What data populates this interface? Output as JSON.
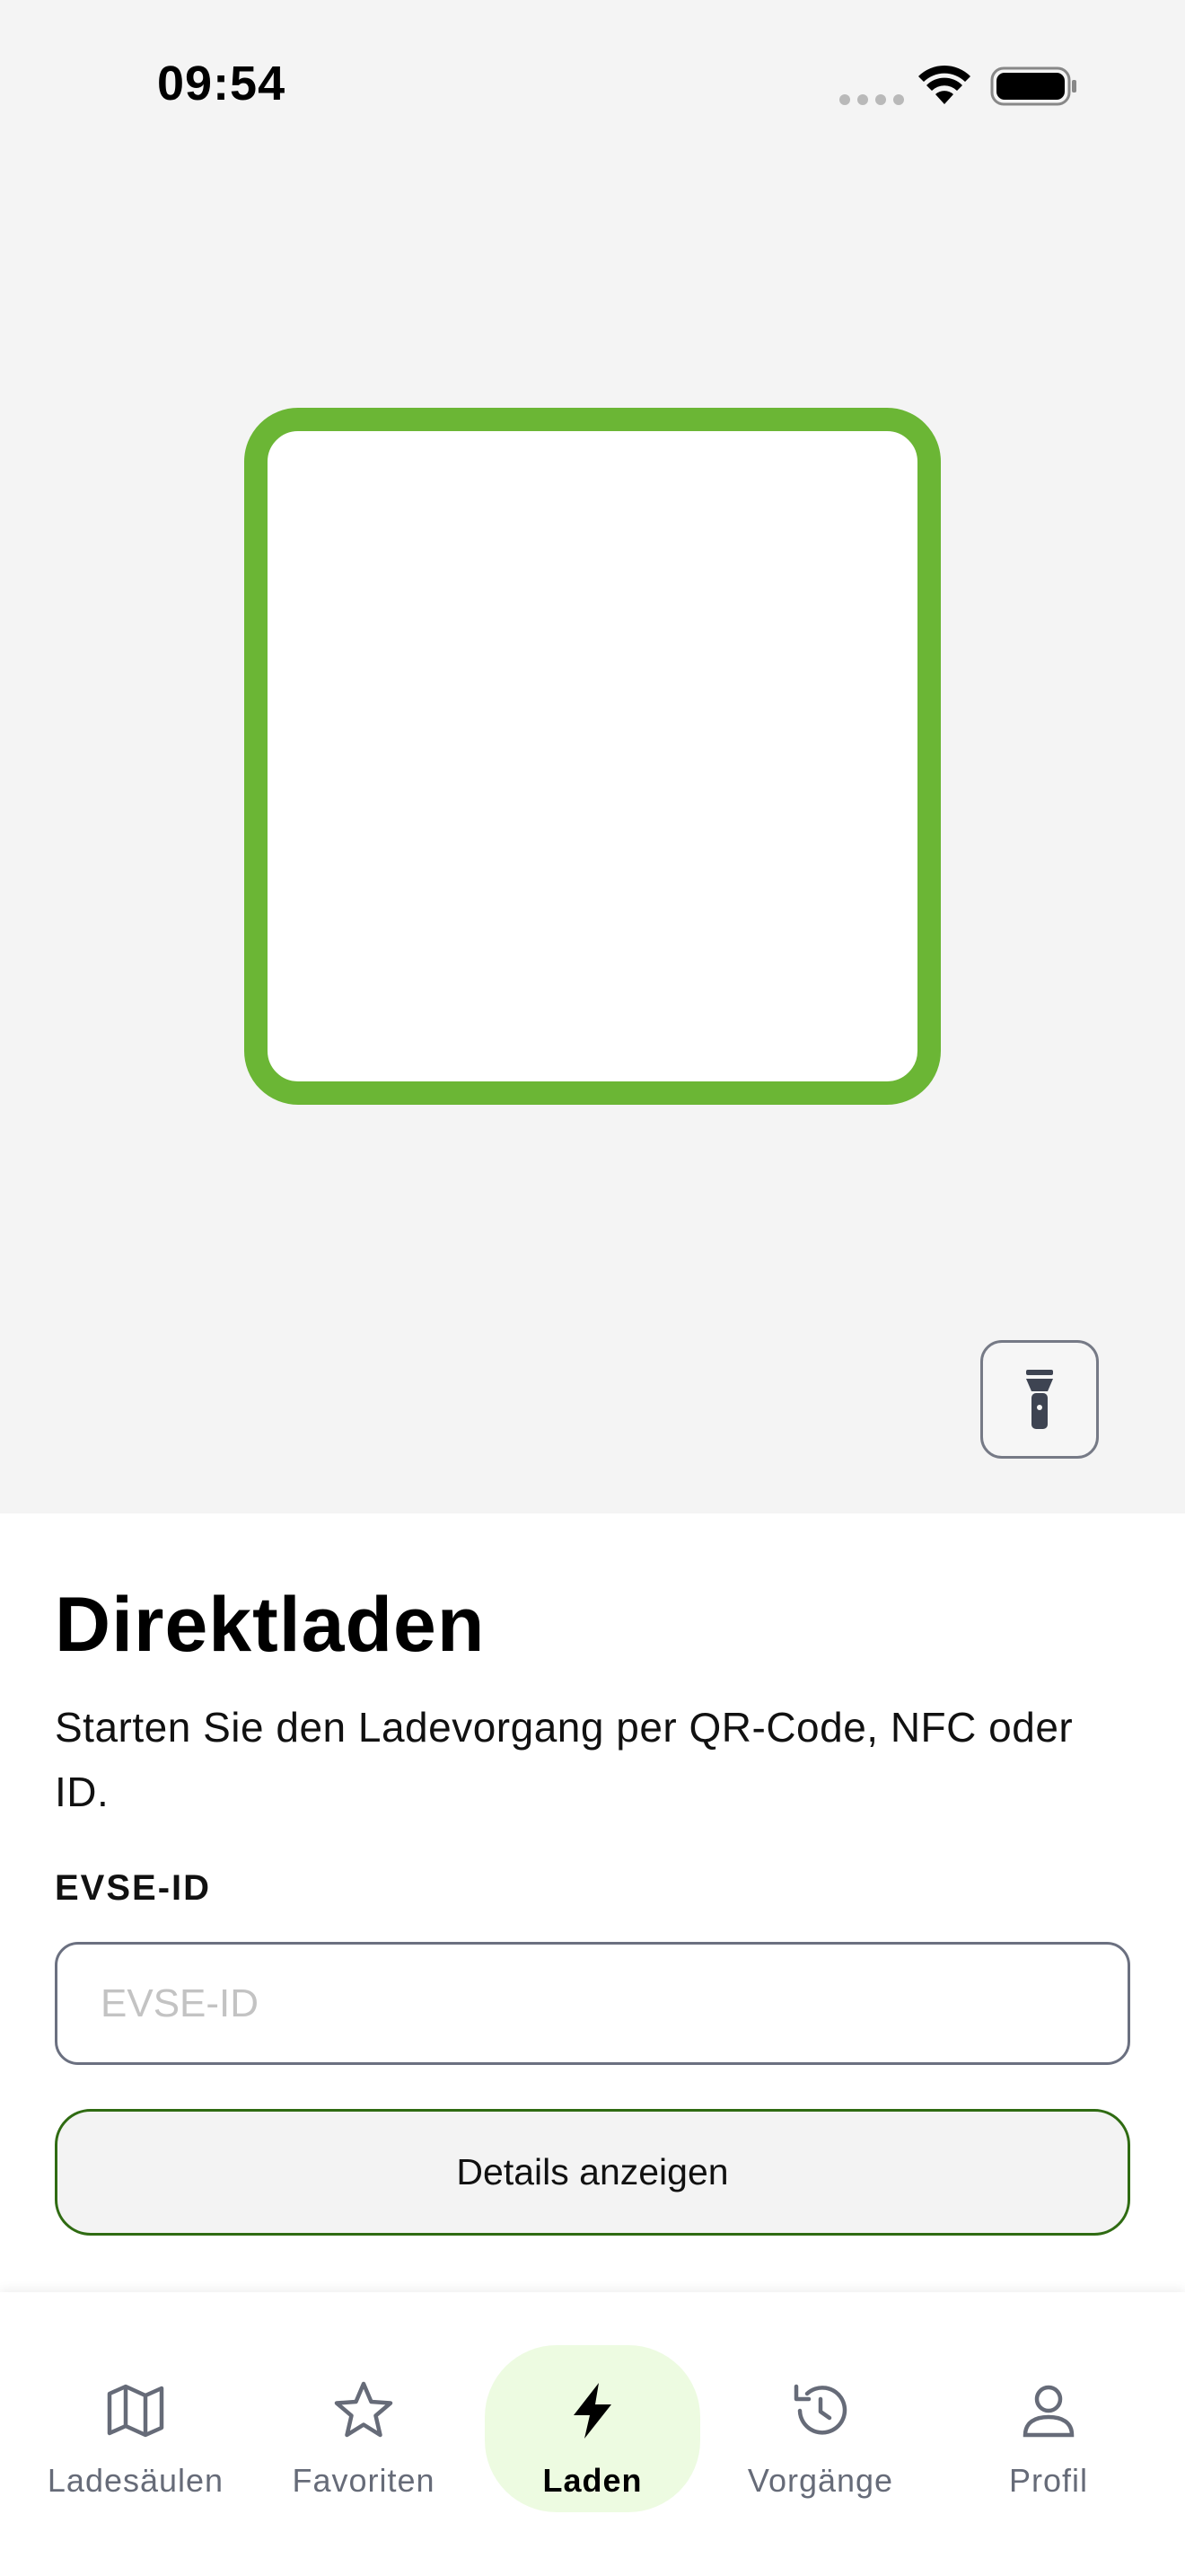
{
  "status_bar": {
    "time": "09:54"
  },
  "scanner": {
    "frame_color": "#6bb635",
    "torch_icon": "flashlight-icon"
  },
  "main": {
    "title": "Direktladen",
    "subtitle": "Starten Sie den Ladevorgang per QR-Code, NFC oder ID.",
    "evse_label": "EVSE-ID",
    "evse_value": "",
    "evse_placeholder": "EVSE-ID",
    "details_button": "Details anzeigen"
  },
  "tab_bar": {
    "active_color": "#edfbe1",
    "items": [
      {
        "label": "Ladesäulen",
        "icon": "map-icon",
        "active": false
      },
      {
        "label": "Favoriten",
        "icon": "star-icon",
        "active": false
      },
      {
        "label": "Laden",
        "icon": "lightning-icon",
        "active": true
      },
      {
        "label": "Vorgänge",
        "icon": "history-icon",
        "active": false
      },
      {
        "label": "Profil",
        "icon": "user-icon",
        "active": false
      }
    ]
  }
}
